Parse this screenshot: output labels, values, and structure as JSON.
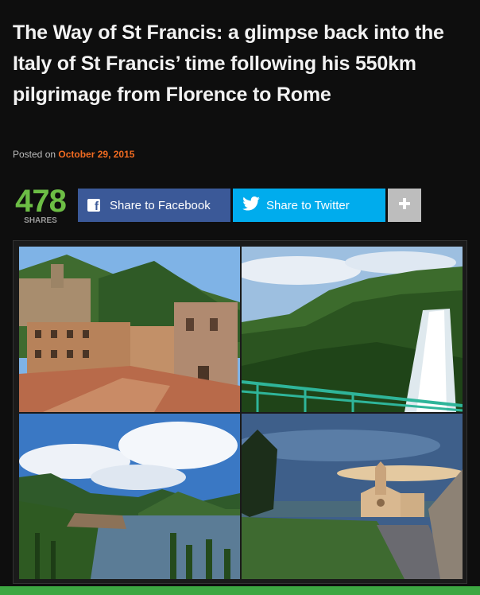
{
  "article": {
    "title": "The Way of St Francis: a glimpse back into the Italy of St Francis’ time following his 550km pilgrimage from Florence to Rome",
    "posted_prefix": "Posted on",
    "posted_date": "October 29, 2015"
  },
  "shares": {
    "count": "478",
    "label": "SHARES"
  },
  "share_buttons": {
    "facebook": "Share to Facebook",
    "twitter": "Share to Twitter",
    "more": "+"
  },
  "gallery": {
    "images": [
      {
        "subject": "hill town piazza with stone palace"
      },
      {
        "subject": "waterfall on green mountainside"
      },
      {
        "subject": "lake with island and hills"
      },
      {
        "subject": "basilica at dusk"
      }
    ]
  },
  "colors": {
    "background": "#0e0e0e",
    "accent_date": "#f26b21",
    "shares_count": "#6cbd45",
    "facebook": "#3b5998",
    "twitter": "#00aced",
    "more": "#bdbdbd"
  }
}
